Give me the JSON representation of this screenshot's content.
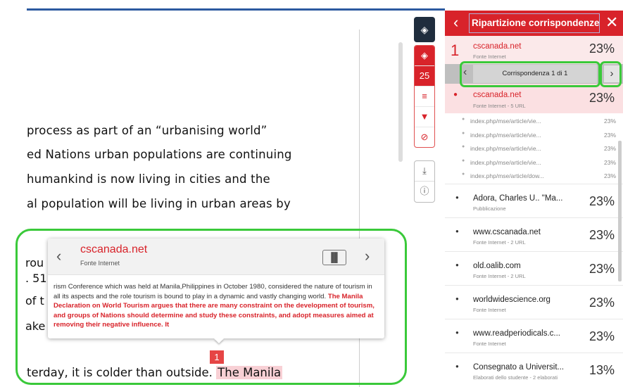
{
  "document": {
    "lines": [
      "process as part of an “urbanising world”",
      "ed Nations urban populations are continuing",
      "humankind is now living in cities and the",
      "al population will be living in urban areas by"
    ],
    "fragments": [
      "rou",
      ". 51",
      "of t",
      "ake"
    ],
    "last_line_prefix": "terday, it is colder than outside.",
    "last_line_highlight": "The Manila",
    "marker_number": "1"
  },
  "popup": {
    "source": "cscanada.net",
    "source_type": "Fonte Internet",
    "compare_icon": "◯◯",
    "text_plain": "rism Conference which was held at Manila,Philippines in October 1980, considered the nature of tourism in all its aspects and the role tourism is bound to play in a dynamic and vastly changing world. ",
    "text_match": "The Manila Declaration on World Tourism argues that there are many constraint on the development of tourism, and groups of Nations should determine and study these constraints, and adopt measures aimed at removing their negative influence. It"
  },
  "toolbar": {
    "layers_icon": "layers-icon",
    "count": "25"
  },
  "panel": {
    "title": "Ripartizione corrispondenze",
    "top_source": {
      "number": "1",
      "name": "cscanada.net",
      "type": "Fonte Internet",
      "percent": "23%"
    },
    "navigator_label": "Corrispondenza 1 di 1",
    "selected": {
      "name": "cscanada.net",
      "type": "Fonte Internet - 5 URL",
      "percent": "23%"
    },
    "sub_urls": [
      {
        "url": "index.php/mse/article/vie...",
        "percent": "23%"
      },
      {
        "url": "index.php/mse/article/vie...",
        "percent": "23%"
      },
      {
        "url": "index.php/mse/article/vie...",
        "percent": "23%"
      },
      {
        "url": "index.php/mse/article/vie...",
        "percent": "23%"
      },
      {
        "url": "index.php/mse/article/dow...",
        "percent": "23%"
      }
    ],
    "sources": [
      {
        "name": "Adora, Charles U.. \"Ma...",
        "type": "Pubblicazione",
        "percent": "23%"
      },
      {
        "name": "www.cscanada.net",
        "type": "Fonte Internet - 2 URL",
        "percent": "23%"
      },
      {
        "name": "old.oalib.com",
        "type": "Fonte Internet - 2 URL",
        "percent": "23%"
      },
      {
        "name": "worldwidescience.org",
        "type": "Fonte Internet",
        "percent": "23%"
      },
      {
        "name": "www.readperiodicals.c...",
        "type": "Fonte Internet",
        "percent": "23%"
      },
      {
        "name": "Consegnato a Universit...",
        "type": "Elaborati dello studente - 2 elaborati",
        "percent": "13%"
      }
    ]
  },
  "colors": {
    "brand_red": "#d8232a",
    "highlight_green": "#3ac93a",
    "match_highlight": "#f8d0d5"
  }
}
